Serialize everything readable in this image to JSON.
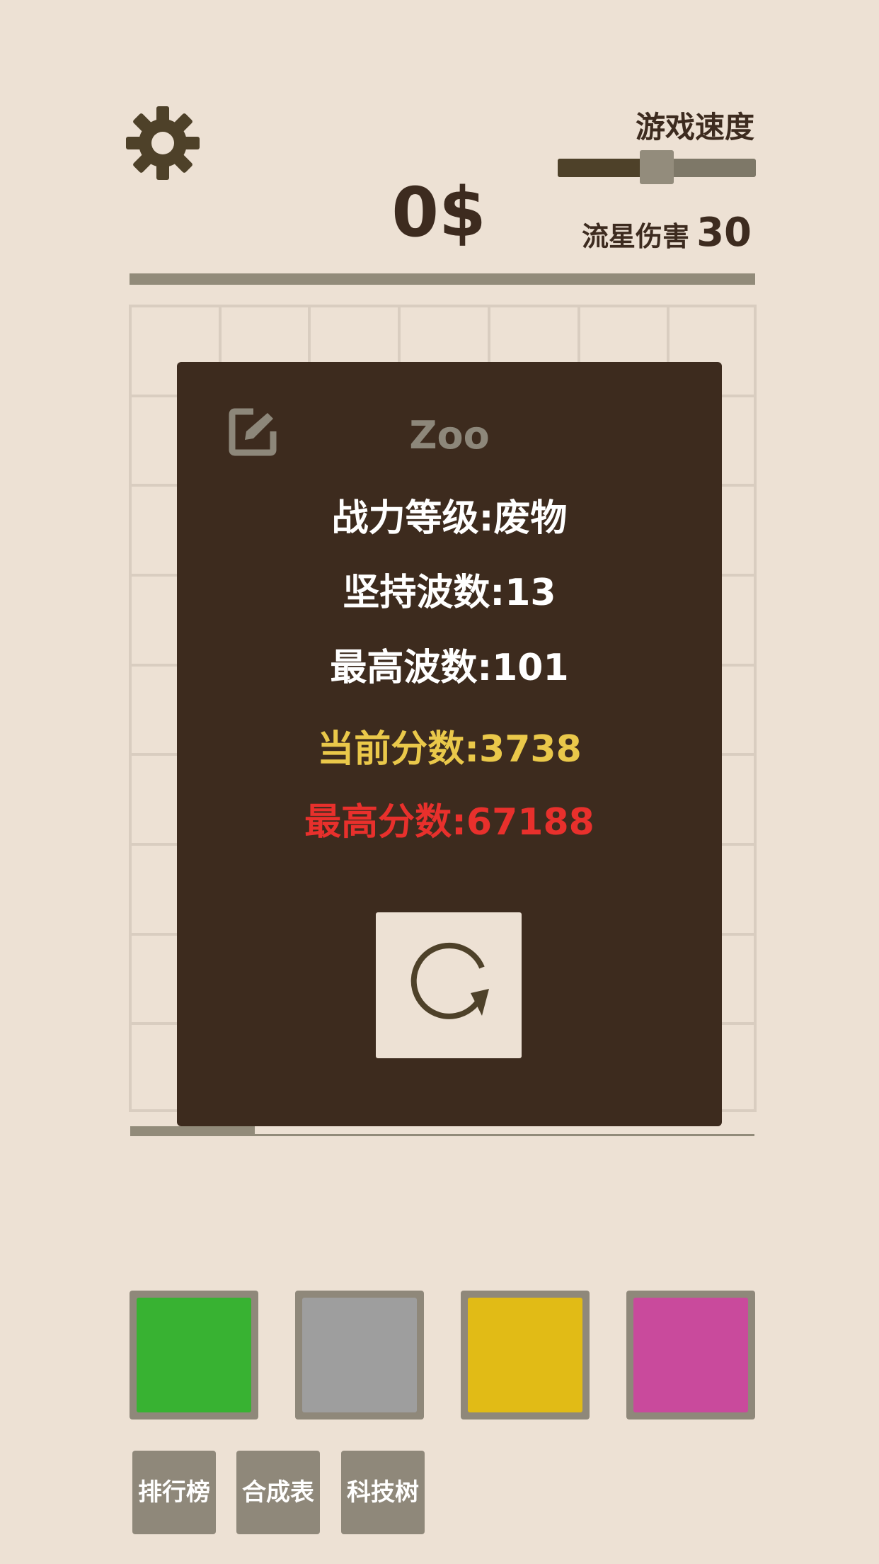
{
  "header": {
    "settings_icon": "gear-icon",
    "speed_label": "游戏速度",
    "speed_value": 0.5,
    "money": "0$",
    "meteor_label": "流星伤害",
    "meteor_value": "30",
    "top_bar_color": "#928b7a"
  },
  "grid": {
    "rows": 9,
    "cols": 7
  },
  "progress": {
    "value": 0.2
  },
  "modal": {
    "edit_icon": "edit-icon",
    "player_name": "Zoo",
    "level": "战力等级:废物",
    "wave": "坚持波数:13",
    "best_wave": "最高波数:101",
    "score": "当前分数:3738",
    "best_score": "最高分数:67188",
    "restart_icon": "restart-icon"
  },
  "colors": {
    "background": "#ede1d4",
    "modal": "#3d2b1e",
    "score": "#eac84a",
    "best_score": "#e8302c"
  },
  "slots": [
    {
      "name": "green",
      "color": "#38b232"
    },
    {
      "name": "gray",
      "color": "#9e9e9e"
    },
    {
      "name": "yellow",
      "color": "#e1bb16"
    },
    {
      "name": "magenta",
      "color": "#c94a9c"
    }
  ],
  "buttons": {
    "leaderboard": "排行榜",
    "recipes": "合成表",
    "tech_tree": "科技树"
  }
}
